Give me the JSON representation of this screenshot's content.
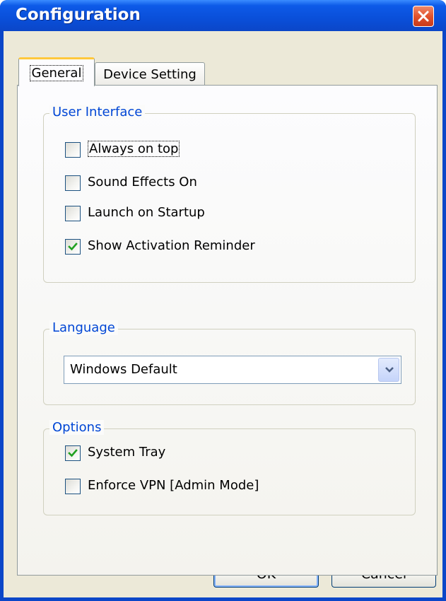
{
  "window": {
    "title": "Configuration"
  },
  "tabs": [
    {
      "label": "General",
      "active": true
    },
    {
      "label": "Device Setting",
      "active": false
    }
  ],
  "user_interface": {
    "legend": "User Interface",
    "items": [
      {
        "label": "Always on top",
        "checked": false
      },
      {
        "label": "Sound Effects On",
        "checked": false
      },
      {
        "label": "Launch on Startup",
        "checked": false
      },
      {
        "label": "Show Activation Reminder",
        "checked": true
      }
    ]
  },
  "language": {
    "legend": "Language",
    "selected": "Windows Default"
  },
  "options": {
    "legend": "Options",
    "items": [
      {
        "label": "System Tray",
        "checked": true
      },
      {
        "label": "Enforce VPN [Admin Mode]",
        "checked": false
      }
    ]
  },
  "buttons": {
    "ok": "OK",
    "cancel": "Cancel"
  },
  "colors": {
    "titlebar": "#0a4fd9",
    "accent_legend": "#0046d5",
    "check_mark": "#21a121",
    "close_button": "#e2532e",
    "tab_highlight": "#ffc83c"
  },
  "icons": {
    "close": "close-icon",
    "dropdown": "chevron-down-icon",
    "check": "checkmark-icon"
  }
}
